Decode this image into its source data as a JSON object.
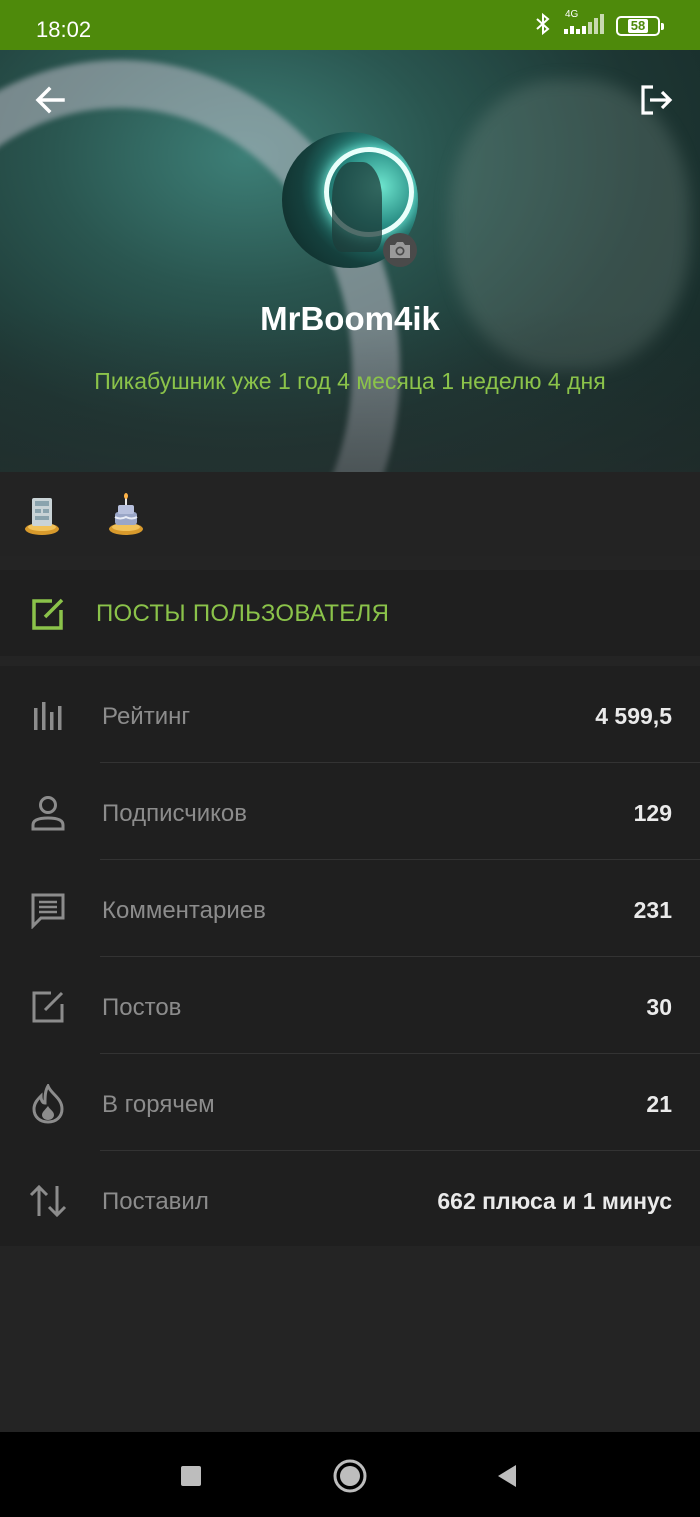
{
  "status_bar": {
    "time": "18:02",
    "network": "4G",
    "battery": "58",
    "icons": [
      "bluetooth-icon",
      "signal-icon",
      "battery-icon"
    ]
  },
  "profile": {
    "username": "MrBoom4ik",
    "tenure": "Пикабушник уже 1 год 4 месяца 1 неделю 4 дня"
  },
  "posts_button": {
    "label": "ПОСТЫ ПОЛЬЗОВАТЕЛЯ"
  },
  "stats": [
    {
      "label": "Рейтинг",
      "value": "4 599,5",
      "icon": "rating-bars-icon"
    },
    {
      "label": "Подписчиков",
      "value": "129",
      "icon": "person-icon"
    },
    {
      "label": "Комментариев",
      "value": "231",
      "icon": "comment-icon"
    },
    {
      "label": "Постов",
      "value": "30",
      "icon": "edit-icon"
    },
    {
      "label": "В горячем",
      "value": "21",
      "icon": "flame-icon"
    },
    {
      "label": "Поставил",
      "value": "662 плюса и 1 минус",
      "icon": "up-down-arrows-icon"
    }
  ],
  "colors": {
    "status_bar": "#4e8a0b",
    "accent": "#8bc34a",
    "background": "#242424",
    "panel": "#1f1f1f"
  }
}
